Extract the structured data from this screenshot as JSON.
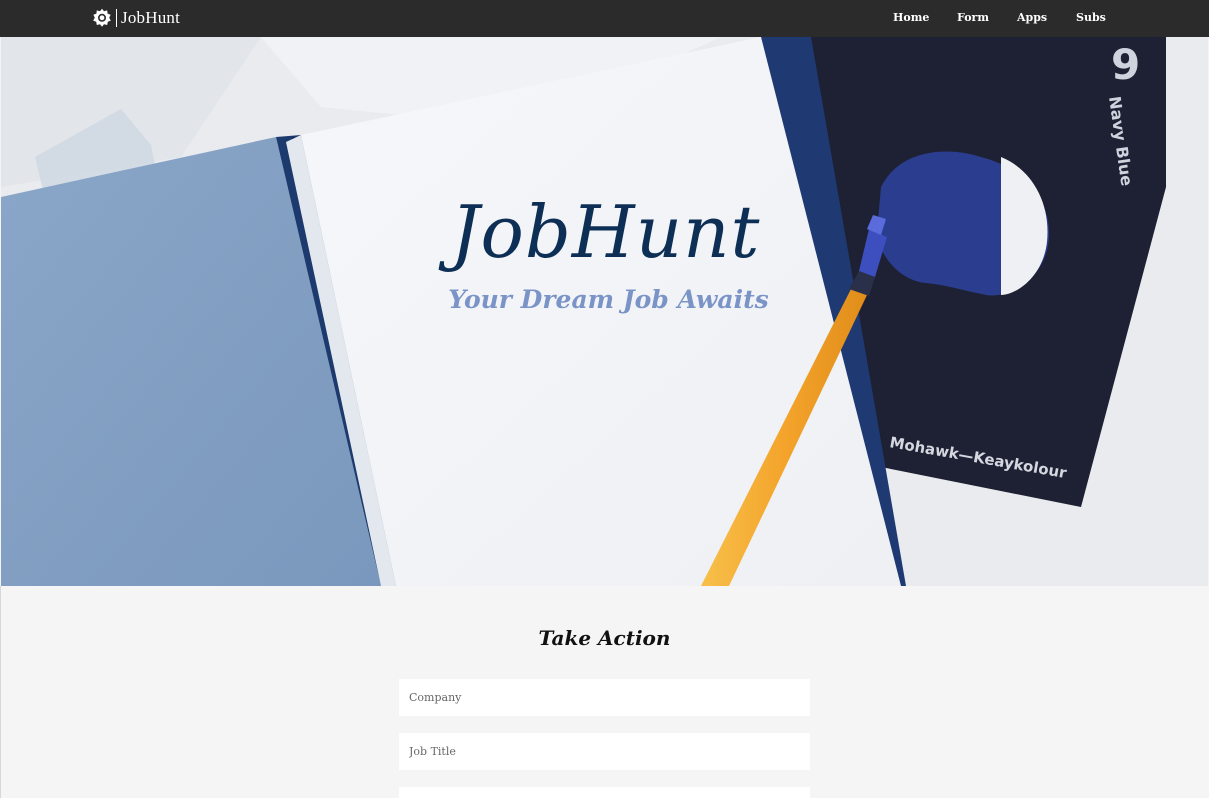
{
  "navbar": {
    "brand": "JobHunt",
    "brand_icon": "gear-icon",
    "links": [
      "Home",
      "Form",
      "Apps",
      "Subs"
    ],
    "background": "#2b2b2b"
  },
  "hero": {
    "title": "JobHunt",
    "subtitle": "Your Dream Job Awaits",
    "title_color": "#0e2f55",
    "subtitle_color": "#7a94c7",
    "card_number": "9",
    "card_color_name": "Navy Blue",
    "card_brand": "Mohawk—Keaykolour"
  },
  "form": {
    "heading": "Take Action",
    "company_placeholder": "Company",
    "job_title_placeholder": "Job Title"
  }
}
